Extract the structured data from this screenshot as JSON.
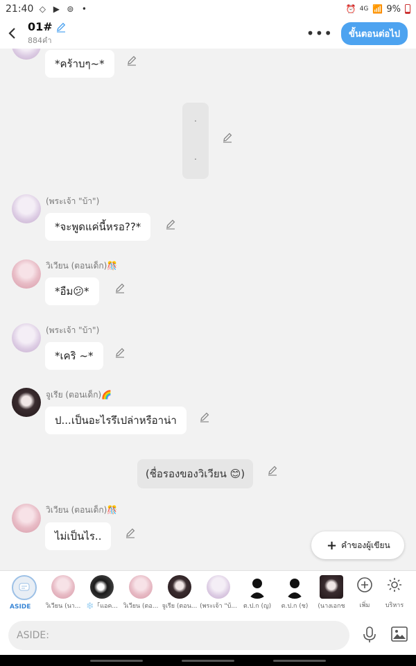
{
  "status": {
    "time": "21:40",
    "network": "4G",
    "battery": "9%"
  },
  "header": {
    "title": "01#",
    "subtitle": "884คำ",
    "next_label": "ขั้นตอนต่อไป"
  },
  "messages": [
    {
      "text": "*คร้าบๆ~*"
    },
    {
      "text_top": "·",
      "text_bottom": "·"
    },
    {
      "name": "(พระเจ้า \"บ้า\")",
      "text": "*จะพูดแค่นี้หรอ??*"
    },
    {
      "name": "วิเวียน (ตอนเด็ก)🎊",
      "text": "*อืม😕*"
    },
    {
      "name": "(พระเจ้า \"บ้า\")",
      "text": "*เคริ ~*"
    },
    {
      "name": "จูเรีย (ตอนเด็ก)🌈",
      "text": "ป...เป็นอะไรรึเปล่าหรือาน่า"
    },
    {
      "text": "(ชื่อรองของวิเวียน 😊)"
    },
    {
      "name": "วิเวียน (ตอนเด็ก)🎊",
      "text": "ไม่เป็นไร.."
    }
  ],
  "fab": {
    "label": "คำของผู้เขียน"
  },
  "characters": {
    "aside": "ASIDE",
    "items": [
      "วิเวียน (นา...",
      "❄️「แอค...",
      "วิเวียน (ตอ...",
      "จูเรีย (ตอน...",
      "(พระเจ้า \"บ้...",
      "ต.ป.ก (ญ)",
      "ต.ป.ก (ช)",
      "(นางเอกช"
    ],
    "add_label": "เพิ่ม",
    "manage_label": "บริหาร"
  },
  "input": {
    "placeholder": "ASIDE:"
  },
  "colors": {
    "accent": "#4da3f0",
    "bubble": "#ffffff",
    "background": "#f2f2f2"
  }
}
